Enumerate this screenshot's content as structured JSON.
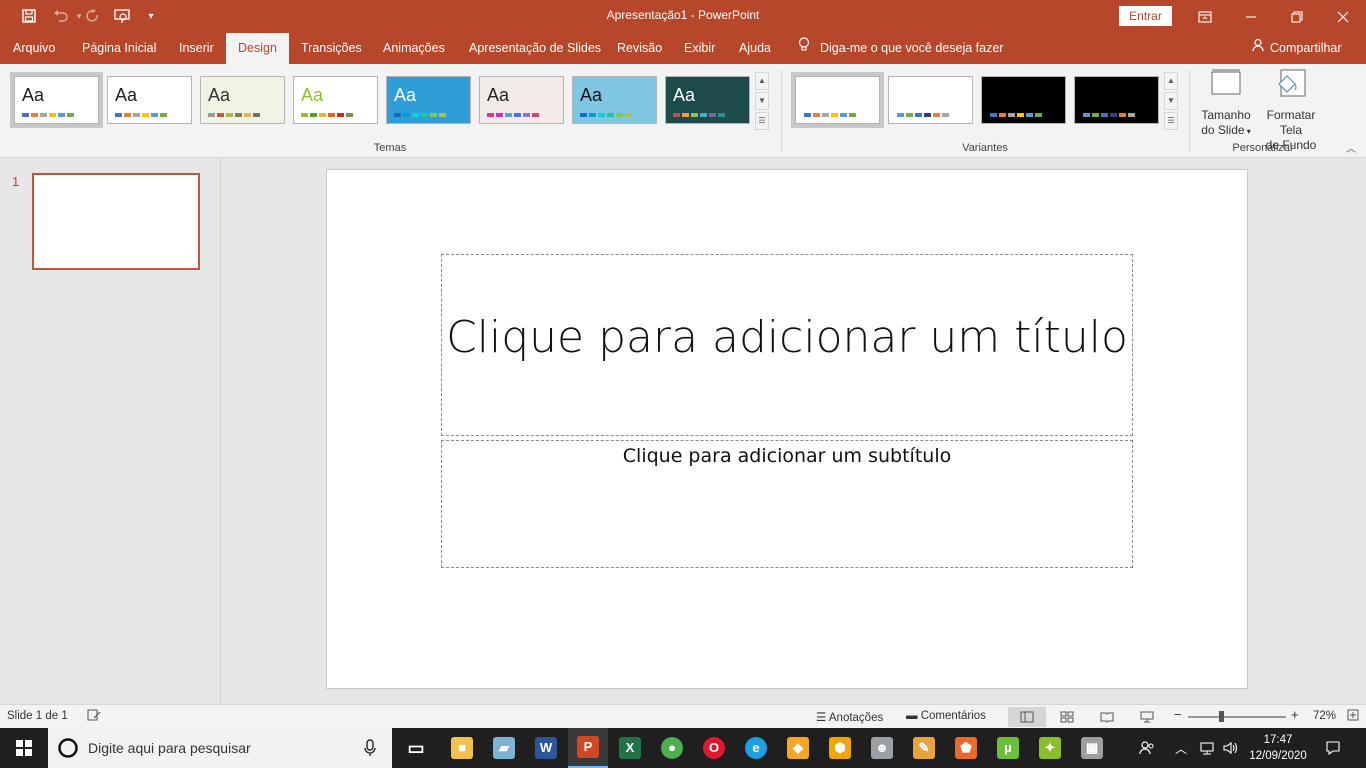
{
  "titlebar": {
    "doc_title": "Apresentação1  -  PowerPoint",
    "sign_in": "Entrar"
  },
  "tabs": [
    {
      "label": "Arquivo"
    },
    {
      "label": "Página Inicial"
    },
    {
      "label": "Inserir"
    },
    {
      "label": "Design"
    },
    {
      "label": "Transições"
    },
    {
      "label": "Animações"
    },
    {
      "label": "Apresentação de Slides"
    },
    {
      "label": "Revisão"
    },
    {
      "label": "Exibir"
    },
    {
      "label": "Ajuda"
    }
  ],
  "tell_me": "Diga-me o que você deseja fazer",
  "share": "Compartilhar",
  "ribbon": {
    "themes_label": "Temas",
    "variants_label": "Variantes",
    "customize_label": "Personalizar",
    "theme_aa": "Aa",
    "slide_size": {
      "line1": "Tamanho",
      "line2": "do Slide"
    },
    "format_bg": {
      "line1": "Formatar Tela",
      "line2": "de Fundo"
    },
    "themes": [
      {
        "bg": "#ffffff",
        "fg": "#222222",
        "colors": [
          "#4472c4",
          "#ed7d31",
          "#a5a5a5",
          "#ffc000",
          "#5b9bd5",
          "#70ad47"
        ]
      },
      {
        "bg": "#ffffff",
        "fg": "#222222",
        "colors": [
          "#4472c4",
          "#ed7d31",
          "#a5a5a5",
          "#ffc000",
          "#5b9bd5",
          "#70ad47"
        ]
      },
      {
        "bg": "#f1f3e3",
        "fg": "#333333",
        "colors": [
          "#93a299",
          "#cf543f",
          "#b5ae53",
          "#848058",
          "#e8b54d",
          "#786c71"
        ]
      },
      {
        "bg": "#ffffff",
        "fg": "#90c226",
        "colors": [
          "#90c226",
          "#54a021",
          "#e6b91e",
          "#e76618",
          "#c42f1a",
          "#918655"
        ]
      },
      {
        "bg": "#2f9ed8",
        "fg": "#ffffff",
        "colors": [
          "#0f6fc6",
          "#009dd9",
          "#0bd0d9",
          "#10cf9b",
          "#7cca62",
          "#a5c249"
        ]
      },
      {
        "bg": "#f3ebe8",
        "fg": "#222222",
        "colors": [
          "#e32d91",
          "#c830cc",
          "#4ea6dc",
          "#4775e7",
          "#8971e1",
          "#d54773"
        ]
      },
      {
        "bg": "#7fc6e3",
        "fg": "#111111",
        "colors": [
          "#0f6fc6",
          "#009dd9",
          "#0bd0d9",
          "#10cf9b",
          "#7cca62",
          "#a5c249"
        ]
      },
      {
        "bg": "#1d4b4c",
        "fg": "#ffffff",
        "colors": [
          "#c0504d",
          "#f79646",
          "#9bbb59",
          "#4bacc6",
          "#8064a2",
          "#2c8c8e"
        ]
      }
    ],
    "variants": [
      {
        "bg": "#ffffff",
        "colors": [
          "#4472c4",
          "#ed7d31",
          "#a5a5a5",
          "#ffc000",
          "#5b9bd5",
          "#70ad47"
        ]
      },
      {
        "bg": "#ffffff",
        "colors": [
          "#5b9bd5",
          "#70ad47",
          "#4472c4",
          "#264478",
          "#ed7d31",
          "#a5a5a5"
        ]
      },
      {
        "bg": "#000000",
        "colors": [
          "#4472c4",
          "#ed7d31",
          "#a5a5a5",
          "#ffc000",
          "#5b9bd5",
          "#70ad47"
        ]
      },
      {
        "bg": "#000000",
        "colors": [
          "#5b9bd5",
          "#70ad47",
          "#4472c4",
          "#264478",
          "#ed7d31",
          "#a5a5a5"
        ]
      }
    ]
  },
  "thumbnails": {
    "slide_number": "1"
  },
  "slide": {
    "title_placeholder": "Clique para adicionar um título",
    "subtitle_placeholder": "Clique para adicionar um subtítulo"
  },
  "statusbar": {
    "slide_counter": "Slide 1 de 1",
    "notes": "Anotações",
    "comments": "Comentários",
    "zoom_level": "72%",
    "zoom_minus": "−",
    "zoom_plus": "+"
  },
  "taskbar": {
    "search_placeholder": "Digite aqui para pesquisar",
    "time": "17:47",
    "date": "12/09/2020",
    "apps": [
      "task-view",
      "file-explorer",
      "notepad",
      "word",
      "powerpoint",
      "excel",
      "chrome",
      "opera",
      "edge",
      "uc-browser",
      "vpn",
      "game-app",
      "paint",
      "app-3d",
      "utorrent",
      "app-green",
      "calculator"
    ]
  },
  "colors": {
    "accent": "#b7472a",
    "ribbon_bg": "#f3f3f3",
    "workspace_bg": "#e6e6e6"
  }
}
